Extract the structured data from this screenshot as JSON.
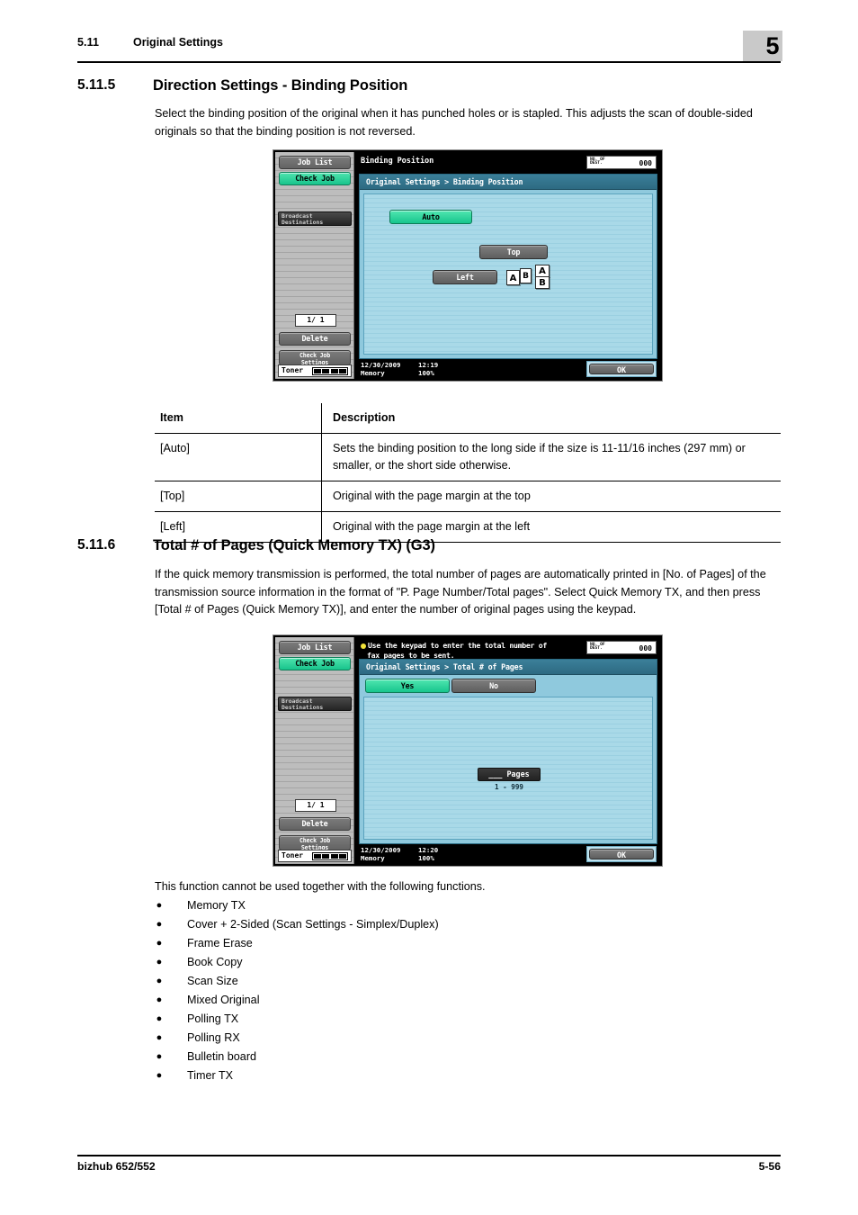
{
  "running_head": {
    "section_number": "5.11",
    "section_title": "Original Settings",
    "chapter": "5"
  },
  "sections": [
    {
      "number": "5.11.5",
      "title": "Direction Settings - Binding Position",
      "paragraph": "Select the binding position of the original when it has punched holes or is stapled. This adjusts the scan of double-sided originals so that the binding position is not reversed."
    },
    {
      "number": "5.11.6",
      "title": "Total # of Pages (Quick Memory TX) (G3)",
      "paragraph": "If the quick memory transmission is performed, the total number of pages are automatically printed in [No. of Pages] of the transmission source information in the format of \"P. Page Number/Total pages\". Select Quick Memory TX, and then press [Total # of Pages (Quick Memory TX)], and enter the number of original pages using the keypad."
    }
  ],
  "screenshot_one": {
    "sidebar": {
      "job_list": "Job List",
      "check_job": "Check Job",
      "broadcast_line1": "Broadcast",
      "broadcast_line2": "Destinations",
      "page_counter": "1/  1",
      "delete": "Delete",
      "check_job_settings_line1": "Check Job",
      "check_job_settings_line2": "Settings",
      "toner_label": "Toner"
    },
    "header_title": "Binding Position",
    "counter": {
      "label_line1": "NO. OF",
      "label_line2": "DEST.",
      "value": "000"
    },
    "breadcrumb": "Original Settings > Binding Position",
    "buttons": {
      "auto": "Auto",
      "top": "Top",
      "left": "Left"
    },
    "page_icons": {
      "left_bound_page_a": "A",
      "left_bound_page_b": "B",
      "top_bound_page_a": "A",
      "top_bound_page_b": "B"
    },
    "status": {
      "date": "12/30/2009",
      "time": "12:19",
      "memory_label": "Memory",
      "memory_value": "100%"
    },
    "ok": "OK"
  },
  "screenshot_two": {
    "sidebar": {
      "job_list": "Job List",
      "check_job": "Check Job",
      "broadcast_line1": "Broadcast",
      "broadcast_line2": "Destinations",
      "page_counter": "1/  1",
      "delete": "Delete",
      "check_job_settings_line1": "Check Job",
      "check_job_settings_line2": "Settings",
      "toner_label": "Toner"
    },
    "message_line1": "Use the keypad to enter the total number of",
    "message_line2": "fax pages to be sent.",
    "counter": {
      "label_line1": "NO. OF",
      "label_line2": "DEST.",
      "value": "000"
    },
    "breadcrumb": "Original Settings > Total # of Pages",
    "buttons": {
      "yes": "Yes",
      "no": "No"
    },
    "pages_field": "___ Pages",
    "pages_range": "1  -  999",
    "status": {
      "date": "12/30/2009",
      "time": "12:20",
      "memory_label": "Memory",
      "memory_value": "100%"
    },
    "ok": "OK"
  },
  "table": {
    "headers": [
      "Item",
      "Description"
    ],
    "rows": [
      [
        "[Auto]",
        "Sets the binding position to the long side if the size is 11-11/16 inches (297 mm) or smaller, or the short side otherwise."
      ],
      [
        "[Top]",
        "Original with the page margin at the top"
      ],
      [
        "[Left]",
        "Original with the page margin at the left"
      ]
    ]
  },
  "conflict_list": {
    "intro": "This function cannot be used together with the following functions.",
    "bullet": "●",
    "items": [
      "Memory TX",
      "Cover + 2-Sided (Scan Settings - Simplex/Duplex)",
      "Frame Erase",
      "Book Copy",
      "Scan Size",
      "Mixed Original",
      "Polling TX",
      "Polling RX",
      "Bulletin board",
      "Timer TX"
    ]
  },
  "footer": {
    "product": "bizhub 652/552",
    "page_number": "5-56"
  }
}
